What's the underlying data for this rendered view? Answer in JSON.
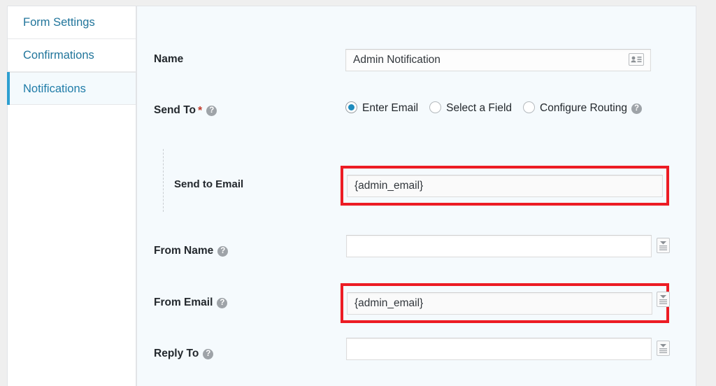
{
  "sidebar": {
    "items": [
      {
        "label": "Form Settings",
        "state": "normal",
        "name": "sidebar-item-form-settings"
      },
      {
        "label": "Confirmations",
        "state": "normal",
        "name": "sidebar-item-confirmations"
      },
      {
        "label": "Notifications",
        "state": "active",
        "name": "sidebar-item-notifications"
      }
    ]
  },
  "colors": {
    "link": "#21759b",
    "accent": "#2e9fd0",
    "highlight": "#ec1c24",
    "required": "#c0392b",
    "panel_bg": "#f5fafd"
  },
  "form": {
    "name_row": {
      "label": "Name",
      "value": "Admin Notification",
      "placeholder": "",
      "inline_icon": "contact-card-icon"
    },
    "send_to_row": {
      "label": "Send To",
      "required_marker": "*",
      "help_icon": "?",
      "options": [
        {
          "label": "Enter Email",
          "checked": true
        },
        {
          "label": "Select a Field",
          "checked": false
        },
        {
          "label": "Configure Routing",
          "checked": false,
          "help_icon": "?"
        }
      ]
    },
    "send_to_email_row": {
      "label": "Send to Email",
      "value": "{admin_email}",
      "placeholder": "",
      "highlighted": true
    },
    "from_name_row": {
      "label": "From Name",
      "help_icon": "?",
      "value": "",
      "placeholder": "",
      "tag_button_icon": "merge-tag-icon",
      "highlighted": false
    },
    "from_email_row": {
      "label": "From Email",
      "help_icon": "?",
      "value": "{admin_email}",
      "placeholder": "",
      "tag_button_icon": "merge-tag-icon",
      "highlighted": true
    },
    "reply_to_row": {
      "label": "Reply To",
      "help_icon": "?",
      "value": "",
      "placeholder": "",
      "tag_button_icon": "merge-tag-icon",
      "highlighted": false
    }
  }
}
